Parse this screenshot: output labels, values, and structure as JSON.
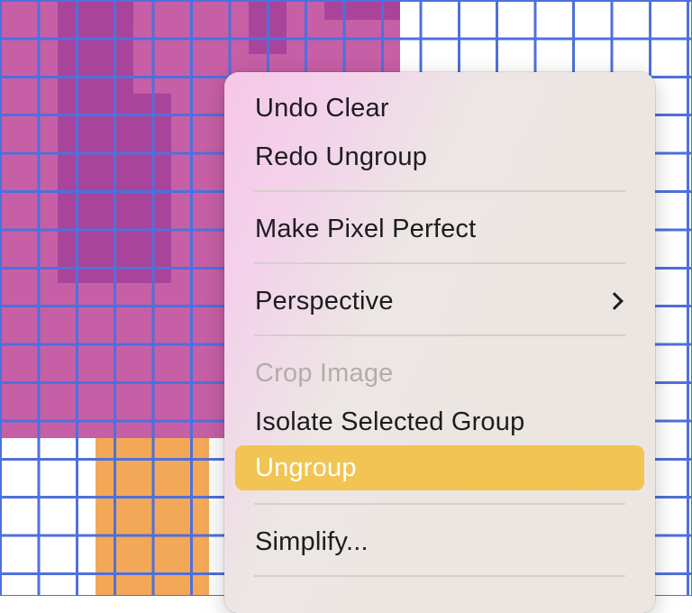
{
  "colors": {
    "grid_line": "#4f70dc",
    "pink_fill": "#c75fa6",
    "magenta_fill": "#a9449b",
    "orange_fill": "#f3a857",
    "highlight": "#f1c453"
  },
  "context_menu": {
    "items": [
      {
        "label": "Undo Clear",
        "enabled": true
      },
      {
        "label": "Redo Ungroup",
        "enabled": true
      },
      {
        "label": "Make Pixel Perfect",
        "enabled": true
      },
      {
        "label": "Perspective",
        "enabled": true,
        "submenu_icon": "chevron-right-icon"
      },
      {
        "label": "Crop Image",
        "enabled": false
      },
      {
        "label": "Isolate Selected Group",
        "enabled": true
      },
      {
        "label": "Ungroup",
        "enabled": true,
        "highlighted": true
      },
      {
        "label": "Simplify...",
        "enabled": true
      }
    ]
  }
}
